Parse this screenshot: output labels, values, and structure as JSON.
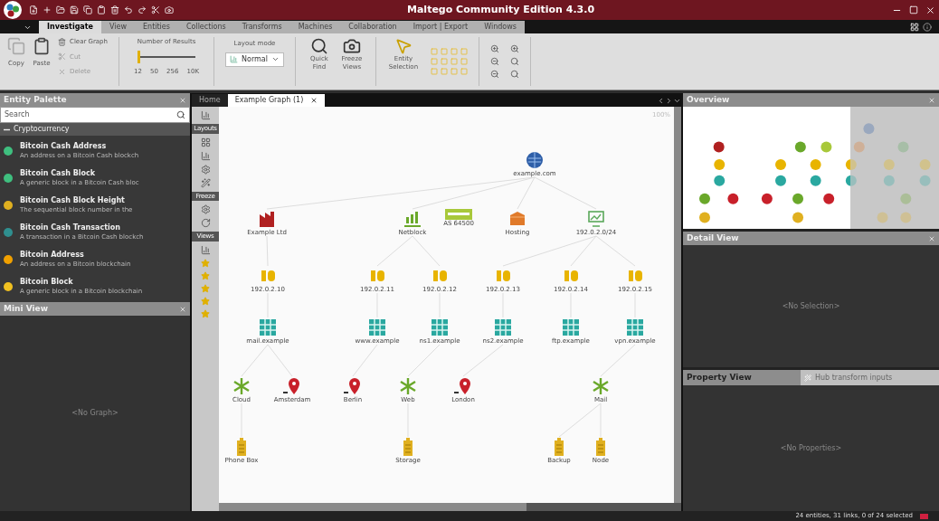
{
  "window": {
    "title": "Maltego Community Edition 4.3.0"
  },
  "menu_tabs": [
    {
      "label": "Investigate",
      "selected": true
    },
    {
      "label": "View",
      "selected": false
    },
    {
      "label": "Entities",
      "selected": false
    },
    {
      "label": "Collections",
      "selected": false
    },
    {
      "label": "Transforms",
      "selected": false
    },
    {
      "label": "Machines",
      "selected": false
    },
    {
      "label": "Collaboration",
      "selected": false
    },
    {
      "label": "Import | Export",
      "selected": false
    },
    {
      "label": "Windows",
      "selected": false
    }
  ],
  "ribbon": {
    "copy": "Copy",
    "paste": "Paste",
    "clear_graph": "Clear Graph",
    "cut": "Cut",
    "delete": "Delete",
    "results": {
      "label": "Number of Results",
      "level": 0,
      "ticks": [
        "12",
        "50",
        "256",
        "10K"
      ]
    },
    "mode": {
      "label": "Layout mode",
      "value": "Normal"
    },
    "quick_find": "Quick Find",
    "freeze_views": "Freeze Views",
    "entity_selection": "Entity Selection"
  },
  "palette": {
    "title": "Entity Palette",
    "search_placeholder": "Search",
    "category": {
      "label": "Cryptocurrency",
      "expanded": true
    },
    "items": [
      {
        "name": "Bitcoin Cash Address",
        "description": "An address on a Bitcoin Cash blockch",
        "color": "#3fbf7f"
      },
      {
        "name": "Bitcoin Cash Block",
        "description": "A generic block in a Bitcoin Cash bloc",
        "color": "#3fbf7f"
      },
      {
        "name": "Bitcoin Cash Block Height",
        "description": "The sequential block number in the",
        "color": "#e0b020"
      },
      {
        "name": "Bitcoin Cash Transaction",
        "description": "A transaction in a Bitcoin Cash blockch",
        "color": "#2f8f8f"
      },
      {
        "name": "Bitcoin Address",
        "description": "An address on a Bitcoin blockchain",
        "color": "#f0a000"
      },
      {
        "name": "Bitcoin Block",
        "description": "A generic block in a Bitcoin blockchain",
        "color": "#f0c020"
      }
    ]
  },
  "mini_view": {
    "title": "Mini View",
    "message": "<No Graph>"
  },
  "graph_tabs": [
    {
      "label": "Home",
      "selected": false
    },
    {
      "label": "Example Graph (1)",
      "selected": true
    }
  ],
  "graph_toolbar": [
    "Layouts",
    "Freeze",
    "Views"
  ],
  "graph": {
    "zoom": "100%",
    "nodes": [
      {
        "kind": "globe",
        "label": "example.com"
      },
      {
        "kind": "company",
        "label": "Example Ltd"
      },
      {
        "kind": "network",
        "label": "Netblock"
      },
      {
        "kind": "bar",
        "label": "AS 64500"
      },
      {
        "kind": "box",
        "label": "Hosting"
      },
      {
        "kind": "monitor",
        "label": "192.0.2.0/24"
      },
      {
        "kind": "io",
        "label": "192.0.2.10"
      },
      {
        "kind": "io",
        "label": "192.0.2.11"
      },
      {
        "kind": "io",
        "label": "192.0.2.12"
      },
      {
        "kind": "io",
        "label": "192.0.2.13"
      },
      {
        "kind": "io",
        "label": "192.0.2.14"
      },
      {
        "kind": "io",
        "label": "192.0.2.15"
      },
      {
        "kind": "grid",
        "label": "mail.example"
      },
      {
        "kind": "grid",
        "label": "www.example"
      },
      {
        "kind": "grid",
        "label": "ns1.example"
      },
      {
        "kind": "grid",
        "label": "ns2.example"
      },
      {
        "kind": "grid",
        "label": "ftp.example"
      },
      {
        "kind": "grid",
        "label": "vpn.example"
      },
      {
        "kind": "asterisk",
        "label": "Cloud"
      },
      {
        "kind": "pin",
        "label": "Amsterdam"
      },
      {
        "kind": "pin",
        "label": "Berlin"
      },
      {
        "kind": "asterisk",
        "label": "Web"
      },
      {
        "kind": "pin",
        "label": "London"
      },
      {
        "kind": "asterisk",
        "label": "Mail"
      },
      {
        "kind": "battery",
        "label": "Phone Box"
      },
      {
        "kind": "battery",
        "label": "Storage"
      },
      {
        "kind": "battery",
        "label": "Backup"
      },
      {
        "kind": "battery",
        "label": "Node"
      }
    ]
  },
  "overview": {
    "title": "Overview"
  },
  "detail_view": {
    "title": "Detail View",
    "message": "<No Selection>"
  },
  "property_view": {
    "title": "Property View",
    "button": "Hub transform inputs",
    "message": "<No Properties>"
  },
  "status_bar": "24 entities, 31 links, 0 of 24 selected"
}
